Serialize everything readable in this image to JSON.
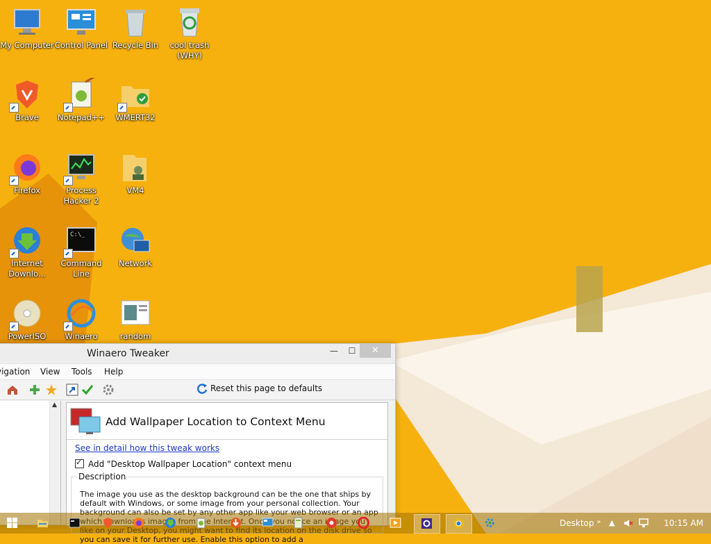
{
  "desktop": {
    "icons": [
      {
        "label": "My Computer",
        "icon": "computer-icon"
      },
      {
        "label": "Control Panel",
        "icon": "control-panel-icon"
      },
      {
        "label": "Recycle Bin",
        "icon": "recycle-bin-icon"
      },
      {
        "label": "cool trash (WHY)",
        "icon": "recycle-bin-full-icon"
      },
      {
        "label": "Brave",
        "icon": "brave-icon"
      },
      {
        "label": "Notepad++",
        "icon": "notepad-plus-icon"
      },
      {
        "label": "WMERT32",
        "icon": "folder-shield-icon"
      },
      {
        "label": "Firefox",
        "icon": "firefox-icon"
      },
      {
        "label": "Process Hacker 2",
        "icon": "process-hacker-icon"
      },
      {
        "label": "VM4",
        "icon": "user-folder-icon"
      },
      {
        "label": "Internet Downlo...",
        "icon": "idm-icon"
      },
      {
        "label": "Command Line",
        "icon": "terminal-icon"
      },
      {
        "label": "Network",
        "icon": "network-icon"
      },
      {
        "label": "PowerISO",
        "icon": "disc-icon"
      },
      {
        "label": "Winaero",
        "icon": "winaero-icon"
      },
      {
        "label": "random",
        "icon": "document-icon"
      }
    ]
  },
  "window": {
    "title": "Winaero Tweaker",
    "minimize": "—",
    "maximize": "☐",
    "close": "✕",
    "menu": [
      "vigation",
      "View",
      "Tools",
      "Help"
    ],
    "reset_label": "Reset this page to defaults",
    "page_title": "Add Wallpaper Location to Context Menu",
    "detail_link": "See in detail how this tweak works",
    "checkbox_label": "Add \"Desktop Wallpaper Location\" context menu",
    "checkbox_checked": true,
    "description_label": "Description",
    "description": "The image you use as the desktop background can be the one that ships by default with Windows, or some image from your personal collection. Your background can also be set by any other app like your web browser or an app which downloads images from the Internet. Once you notice an image you like on your Desktop, you might want to find its location on the disk drive so you can save it for further use. Enable this option to add a"
  },
  "taskbar": {
    "items": [
      {
        "icon": "start-windows-icon"
      },
      {
        "icon": "file-explorer-icon"
      },
      {
        "icon": "terminal-icon"
      },
      {
        "icon": "brave-icon"
      },
      {
        "icon": "firefox-icon"
      },
      {
        "icon": "idm-icon"
      },
      {
        "icon": "notepad-plus-icon"
      },
      {
        "icon": "downloader-icon"
      },
      {
        "icon": "control-panel-icon"
      },
      {
        "icon": "document-icon"
      },
      {
        "icon": "avast-icon"
      },
      {
        "icon": "opera-icon"
      },
      {
        "icon": "media-player-icon"
      },
      {
        "icon": "winaero-tweaker-icon"
      },
      {
        "icon": "chrome-icon"
      },
      {
        "icon": "settings-gear-icon"
      }
    ],
    "desktop_label": "Desktop",
    "expand": "»",
    "clock": "10:15 AM"
  },
  "colors": {
    "wallpaper": "#f7b10f",
    "accent": "#1d3ac9"
  }
}
